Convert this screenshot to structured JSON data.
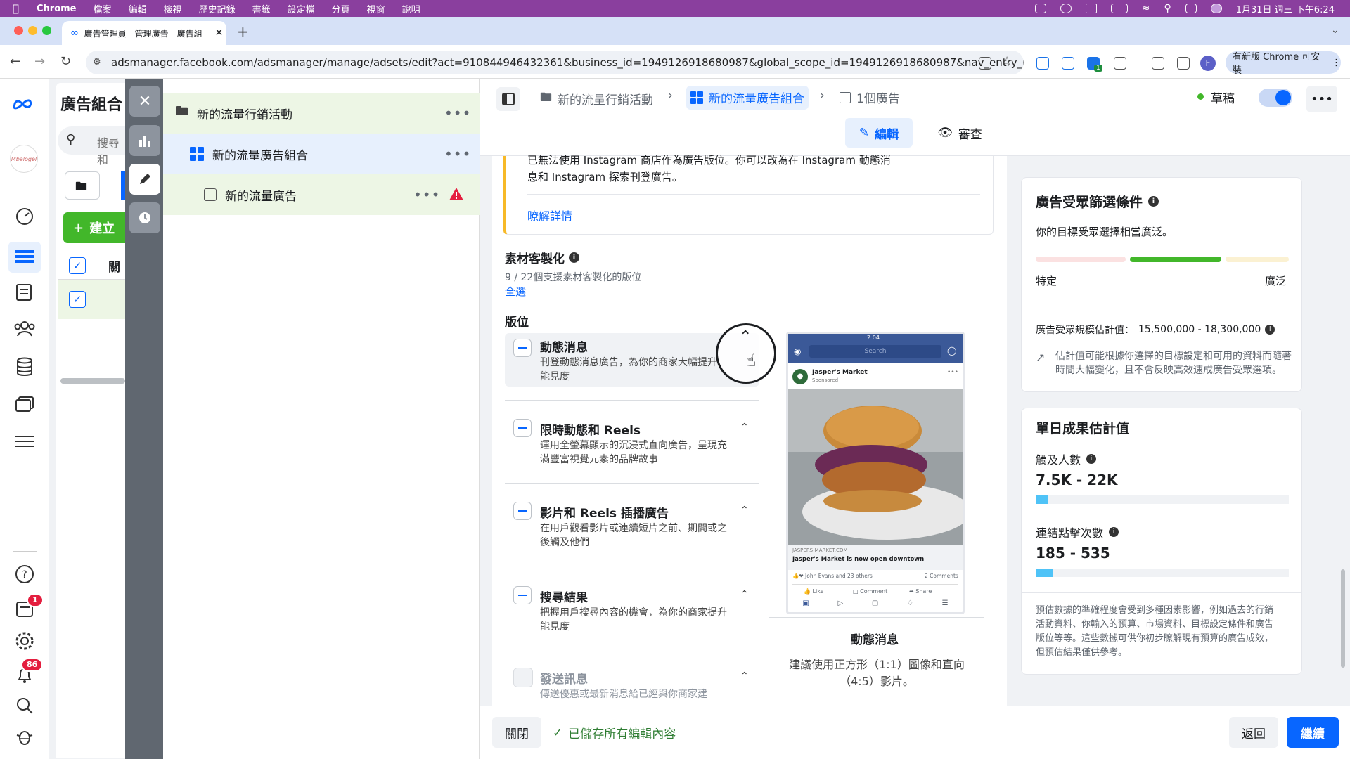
{
  "macos": {
    "app_name": "Chrome",
    "menu": [
      "檔案",
      "編輯",
      "檢視",
      "歷史記錄",
      "書籤",
      "設定檔",
      "分頁",
      "視窗",
      "說明"
    ],
    "clock": "1月31日 週三 下午6:24"
  },
  "browser": {
    "tab_title": "廣告管理員 - 管理廣告 - 廣告組",
    "url": "adsmanager.facebook.com/adsmanager/manage/adsets/edit?act=910844946432361&business_id=1949126918680987&global_scope_id=1949126918680987&nav_entry_point=am_l...",
    "update_button": "有新版 Chrome 可安裝",
    "extension_badge": "1",
    "profile_initial": "F"
  },
  "rail": {
    "logo_text": "Mbalogel",
    "notifications_badge": "1",
    "alerts_badge": "86"
  },
  "behind_panel": {
    "title": "廣告組合",
    "search_placeholder": "搜尋和",
    "create_button": "建立",
    "column_header": "關"
  },
  "tree": {
    "campaign": "新的流量行銷活動",
    "adset": "新的流量廣告組合",
    "ad": "新的流量廣告",
    "more": "•••"
  },
  "header": {
    "breadcrumb_campaign": "新的流量行銷活動",
    "breadcrumb_adset": "新的流量廣告組合",
    "breadcrumb_ad": "1個廣告",
    "status_label": "草稿",
    "edit_tab": "編輯",
    "review_tab": "審查"
  },
  "notice": {
    "line1": "已無法使用 Instagram 商店作為廣告版位。你可以改為在 Instagram 動態消",
    "line2": "息和 Instagram 探索刊登廣告。",
    "learn_more": "瞭解詳情"
  },
  "customization": {
    "title": "素材客製化",
    "count": "9 / 22個支援素材客製化的版位",
    "select_all": "全選",
    "placements_title": "版位"
  },
  "placements": [
    {
      "title": "動態消息",
      "desc": "刊登動態消息廣告，為你的商家大幅提升能見度"
    },
    {
      "title": "限時動態和 Reels",
      "desc": "運用全螢幕顯示的沉浸式直向廣告，呈現充滿豐富視覺元素的品牌故事"
    },
    {
      "title": "影片和 Reels 插播廣告",
      "desc": "在用戶觀看影片或連續短片之前、期間或之後觸及他們"
    },
    {
      "title": "搜尋結果",
      "desc": "把握用戶搜尋內容的機會，為你的商家提升能見度"
    },
    {
      "title": "發送訊息",
      "desc": "傳送優惠或最新消息給已經與你商家建"
    }
  ],
  "preview": {
    "phone_time": "2:04",
    "search": "Search",
    "page_name": "Jasper's Market",
    "sponsored": "Sponsored · ",
    "domain": "JASPERS-MARKET.COM",
    "headline": "Jasper's Market is now open downtown",
    "reactions": "John Evans and 23 others",
    "comments": "2 Comments",
    "like": "Like",
    "comment": "Comment",
    "share": "Share",
    "caption_title": "動態消息",
    "caption_line1": "建議使用正方形（1:1）圖像和直向",
    "caption_line2": "（4:5）影片。"
  },
  "audience": {
    "title": "廣告受眾篩選條件",
    "desc": "你的目標受眾選擇相當廣泛。",
    "specific": "特定",
    "broad": "廣泛",
    "size_label": "廣告受眾規模估計值：",
    "size_value": "15,500,000 - 18,300,000",
    "note_line1": "估計值可能根據你選擇的目標設定和可用的資料而隨著",
    "note_line2": "時間大幅變化，且不會反映高效速成廣告受眾選項。"
  },
  "daily": {
    "title": "單日成果估計值",
    "reach_label": "觸及人數",
    "reach_value": "7.5K - 22K",
    "reach_fill": 0.05,
    "clicks_label": "連結點擊次數",
    "clicks_value": "185 - 535",
    "clicks_fill": 0.07,
    "disclaimer": [
      "預估數據的準確程度會受到多種因素影響，例如過去的行銷",
      "活動資料、你輸入的預算、市場資料、目標設定條件和廣告",
      "版位等等。這些數據可供你初步瞭解現有預算的廣告成效，",
      "但預估結果僅供參考。"
    ]
  },
  "footer": {
    "close": "關閉",
    "saved": "已儲存所有編輯內容",
    "back": "返回",
    "continue": "繼續"
  },
  "colors": {
    "accent": "#0866ff",
    "menubar": "#8a3f9e",
    "warning": "#f7b928",
    "success": "#42b72a"
  }
}
